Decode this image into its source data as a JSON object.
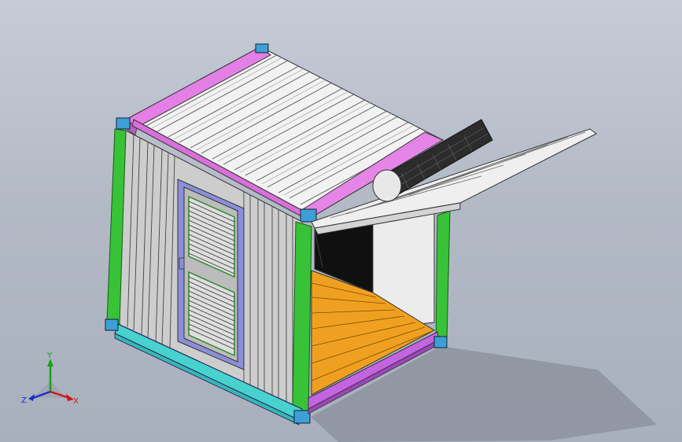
{
  "viewport": {
    "background_top": "#c6ccd6",
    "background_bottom": "#a9b0bd"
  },
  "model": {
    "description_colors": {
      "roof_panel": "#f4f4f4",
      "roof_side_beam": "#e680e8",
      "corner_post": "#38c338",
      "corner_casting": "#3ea0d8",
      "wall_panel": "#cfcfcf",
      "door_frame": "#8b8fd6",
      "floor": "#f0a020",
      "base_beam": "#47d3cf",
      "interior": "#ececec",
      "opening": "#0f0f0f",
      "vent": "#2b2b2b"
    }
  },
  "triad": {
    "x_label": "X",
    "y_label": "Y",
    "z_label": "Z",
    "x_color": "#d01818",
    "y_color": "#18a018",
    "z_color": "#1830c8"
  }
}
